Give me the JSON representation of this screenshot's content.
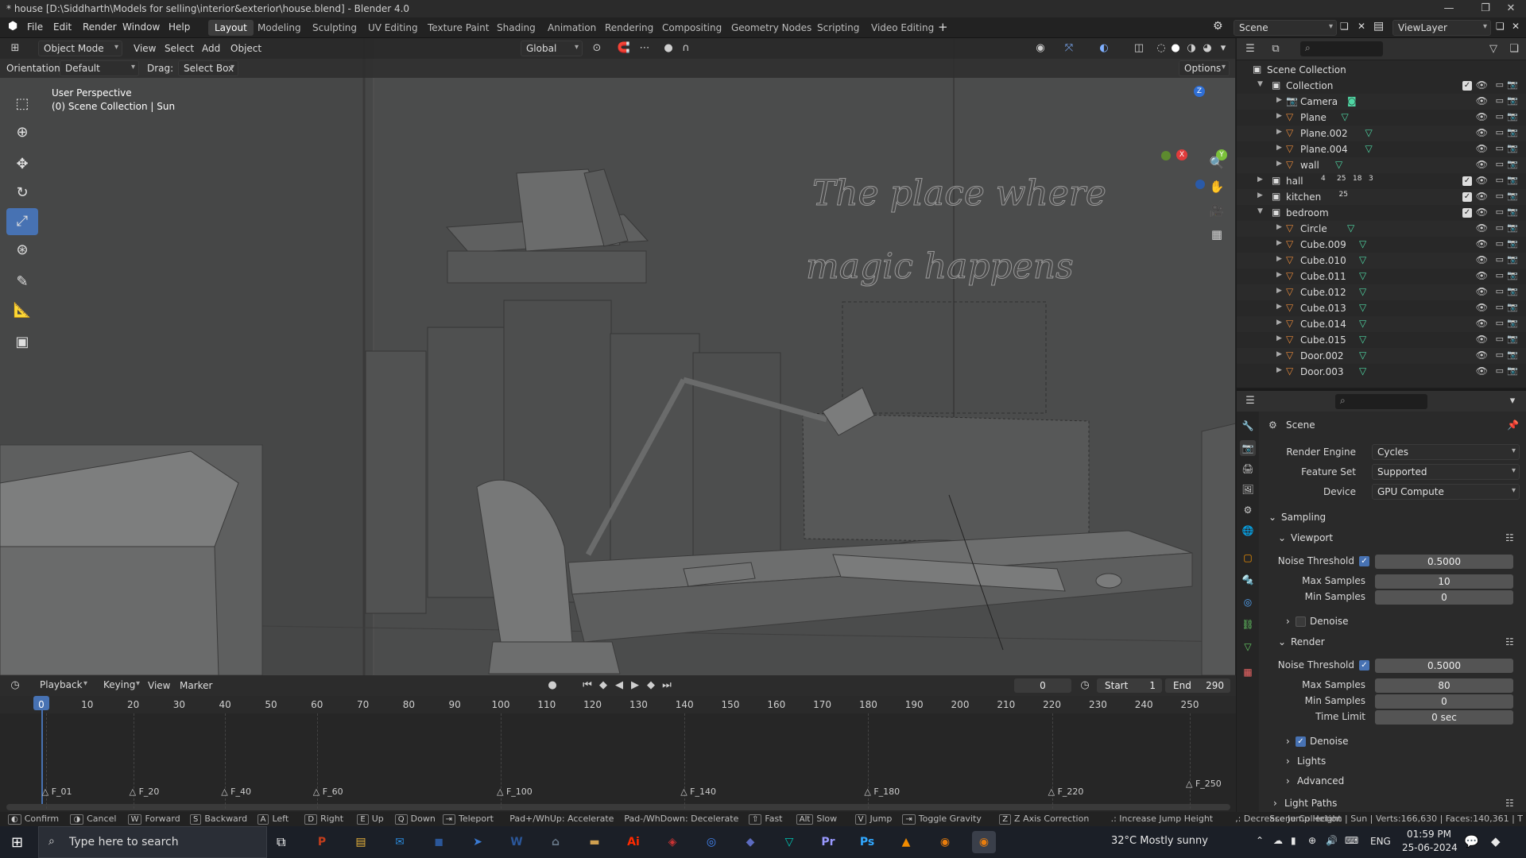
{
  "window": {
    "title": "* house [D:\\Siddharth\\Models for selling\\interior&exterior\\house.blend] - Blender 4.0"
  },
  "menu": [
    "File",
    "Edit",
    "Render",
    "Window",
    "Help"
  ],
  "workspaces": [
    {
      "label": "Layout",
      "active": true
    },
    {
      "label": "Modeling"
    },
    {
      "label": "Sculpting"
    },
    {
      "label": "UV Editing"
    },
    {
      "label": "Texture Paint"
    },
    {
      "label": "Shading"
    },
    {
      "label": "Animation"
    },
    {
      "label": "Rendering"
    },
    {
      "label": "Compositing"
    },
    {
      "label": "Geometry Nodes"
    },
    {
      "label": "Scripting"
    },
    {
      "label": "Video Editing"
    }
  ],
  "scene_selector": {
    "scene": "Scene",
    "view_layer": "ViewLayer"
  },
  "viewport": {
    "mode": "Object Mode",
    "menus": [
      "View",
      "Select",
      "Add",
      "Object"
    ],
    "transform_orientation": "Global",
    "orientation_label": "Orientation:",
    "orientation_value": "Default",
    "drag_label": "Drag:",
    "drag_value": "Select Box",
    "options_label": "Options",
    "overlay_line1": "User Perspective",
    "overlay_line2": "(0) Scene Collection | Sun",
    "wall_text_line1": "The place where",
    "wall_text_line2": "magic happens",
    "gizmo": {
      "x": "X",
      "y": "Y",
      "z": "Z"
    }
  },
  "outliner": {
    "root": "Scene Collection",
    "rows": [
      {
        "label": "Collection",
        "type": "collection",
        "depth": 1,
        "expanded": true
      },
      {
        "label": "Camera",
        "type": "camera",
        "depth": 2
      },
      {
        "label": "Plane",
        "type": "mesh",
        "depth": 2
      },
      {
        "label": "Plane.002",
        "type": "mesh",
        "depth": 2
      },
      {
        "label": "Plane.004",
        "type": "mesh",
        "depth": 2
      },
      {
        "label": "wall",
        "type": "mesh",
        "depth": 2
      },
      {
        "label": "hall",
        "type": "collection",
        "depth": 1,
        "expanded": false
      },
      {
        "label": "kitchen",
        "type": "collection",
        "depth": 1,
        "expanded": false
      },
      {
        "label": "bedroom",
        "type": "collection",
        "depth": 1,
        "expanded": true
      },
      {
        "label": "Circle",
        "type": "mesh",
        "depth": 2
      },
      {
        "label": "Cube.009",
        "type": "mesh",
        "depth": 2
      },
      {
        "label": "Cube.010",
        "type": "mesh",
        "depth": 2
      },
      {
        "label": "Cube.011",
        "type": "mesh",
        "depth": 2
      },
      {
        "label": "Cube.012",
        "type": "mesh",
        "depth": 2
      },
      {
        "label": "Cube.013",
        "type": "mesh",
        "depth": 2
      },
      {
        "label": "Cube.014",
        "type": "mesh",
        "depth": 2
      },
      {
        "label": "Cube.015",
        "type": "mesh",
        "depth": 2
      },
      {
        "label": "Door.002",
        "type": "mesh",
        "depth": 2
      },
      {
        "label": "Door.003",
        "type": "mesh",
        "depth": 2
      }
    ],
    "badges": {
      "hall": [
        "4",
        "25",
        "18",
        "3"
      ],
      "kitchen": [
        "25"
      ]
    }
  },
  "properties": {
    "context": "Scene",
    "render_engine_label": "Render Engine",
    "render_engine": "Cycles",
    "feature_set_label": "Feature Set",
    "feature_set": "Supported",
    "device_label": "Device",
    "device": "GPU Compute",
    "sampling_label": "Sampling",
    "viewport_label": "Viewport",
    "render_label": "Render",
    "noise_threshold_label": "Noise Threshold",
    "max_samples_label": "Max Samples",
    "min_samples_label": "Min Samples",
    "time_limit_label": "Time Limit",
    "denoise_label": "Denoise",
    "lights_label": "Lights",
    "advanced_label": "Advanced",
    "light_paths_label": "Light Paths",
    "viewport_noise_threshold": "0.5000",
    "viewport_max_samples": "10",
    "viewport_min_samples": "0",
    "render_noise_threshold": "0.5000",
    "render_max_samples": "80",
    "render_min_samples": "0",
    "render_time_limit": "0 sec"
  },
  "timeline": {
    "menus": [
      "Playback",
      "Keying",
      "View",
      "Marker"
    ],
    "current_frame": "0",
    "start_label": "Start",
    "start": "1",
    "end_label": "End",
    "end": "290",
    "ticks": [
      "0",
      "10",
      "20",
      "30",
      "40",
      "50",
      "60",
      "70",
      "80",
      "90",
      "100",
      "110",
      "120",
      "130",
      "140",
      "150",
      "160",
      "170",
      "180",
      "190",
      "200",
      "210",
      "220",
      "230",
      "240",
      "250"
    ],
    "markers": [
      "F_01",
      "F_20",
      "F_40",
      "F_60",
      "F_100",
      "F_140",
      "F_180",
      "F_220",
      "F_250"
    ]
  },
  "statusbar": {
    "items": [
      {
        "key": "◐",
        "label": "Confirm"
      },
      {
        "key": "◑",
        "label": "Cancel"
      },
      {
        "key": "W",
        "label": "Forward"
      },
      {
        "key": "S",
        "label": "Backward"
      },
      {
        "key": "A",
        "label": "Left"
      },
      {
        "key": "D",
        "label": "Right"
      },
      {
        "key": "E",
        "label": "Up"
      },
      {
        "key": "Q",
        "label": "Down"
      },
      {
        "key": "⇥",
        "label": "Teleport"
      },
      {
        "key": "",
        "label": "Pad+/WhUp: Accelerate"
      },
      {
        "key": "",
        "label": "Pad-/WhDown: Decelerate"
      },
      {
        "key": "⇧",
        "label": "Fast"
      },
      {
        "key": "Alt",
        "label": "Slow"
      },
      {
        "key": "V",
        "label": "Jump"
      },
      {
        "key": "⇥",
        "label": "Toggle Gravity"
      },
      {
        "key": "Z",
        "label": "Z Axis Correction"
      },
      {
        "key": "",
        "label": ".: Increase Jump Height"
      },
      {
        "key": "",
        "label": ",: Decrease Jump Height"
      }
    ],
    "stats": "Scene Collection | Sun | Verts:166,630 | Faces:140,361 | T"
  },
  "taskbar": {
    "search_placeholder": "Type here to search",
    "weather": "32°C  Mostly sunny",
    "language": "ENG",
    "time": "01:59 PM",
    "date": "25-06-2024",
    "apps": [
      "P",
      "▤",
      "✉",
      "◼",
      "➤",
      "W",
      "⌂",
      "▬",
      "Ai",
      "◈",
      "◎",
      "◆",
      "▽",
      "Pr",
      "Ps",
      "▲",
      "◉",
      "◉"
    ]
  },
  "colors": {
    "accent": "#4772b3",
    "mesh_icon": "#4fd6a3",
    "object_icon": "#e8893a",
    "collection_icon": "#dcdcdc"
  }
}
